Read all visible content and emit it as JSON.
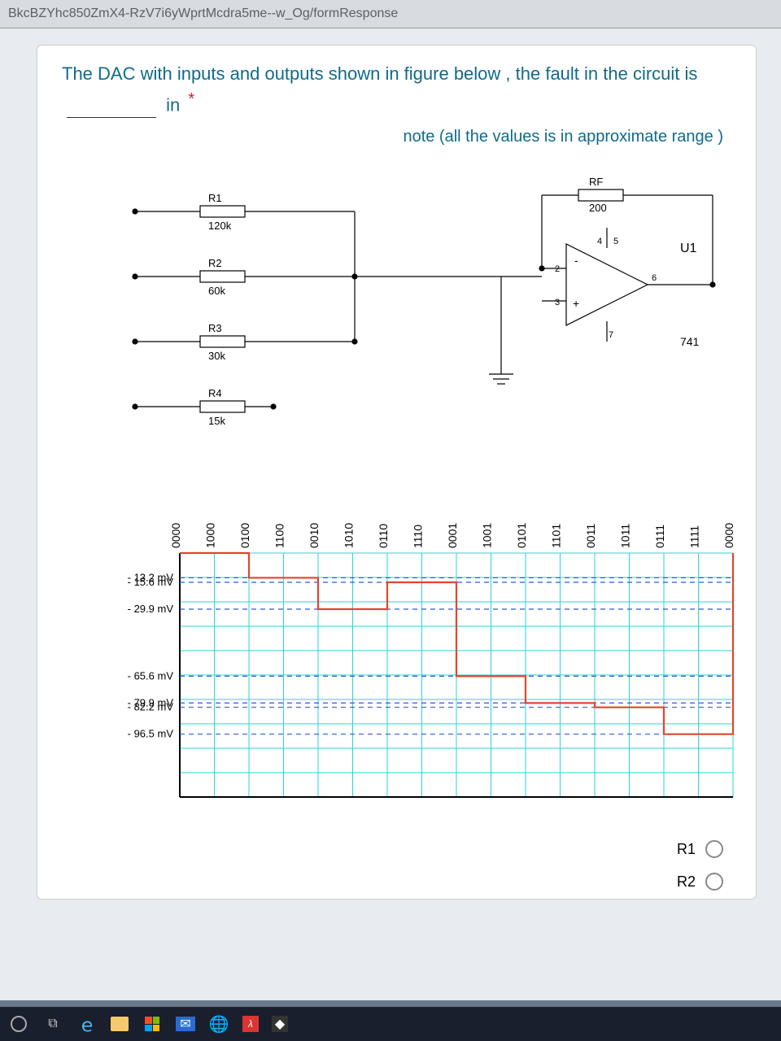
{
  "url": "BkcBZYhc850ZmX4-RzV7i6yWprtMcdra5me--w_Og/formResponse",
  "question": {
    "text_before": "The DAC with inputs and outputs shown in figure below , the fault in the circuit is",
    "text_after": "in",
    "asterisk": "*",
    "note": "note (all the values is in approximate range )"
  },
  "circuit": {
    "r1": {
      "label": "R1",
      "value": "120k"
    },
    "r2": {
      "label": "R2",
      "value": "60k"
    },
    "r3": {
      "label": "R3",
      "value": "30k"
    },
    "r4": {
      "label": "R4",
      "value": "15k"
    },
    "rf": {
      "label": "RF",
      "value": "200"
    },
    "u1": {
      "label": "U1",
      "part": "741"
    },
    "pins": {
      "in_minus": "2",
      "in_plus": "3",
      "v_minus": "4",
      "v_plus": "5",
      "out": "6",
      "nc": "7"
    }
  },
  "chart_data": {
    "type": "line",
    "x_labels": [
      "0000",
      "1000",
      "0100",
      "1100",
      "0010",
      "1010",
      "0110",
      "1110",
      "0001",
      "1001",
      "0101",
      "1101",
      "0011",
      "1011",
      "0111",
      "1111",
      "0000"
    ],
    "y_labels": [
      "- 13.2 mV",
      "- 15.6 mV",
      "- 29.9 mV",
      "- 65.6 mV",
      "- 79.9 mV",
      "- 82.2 mV",
      "- 96.5 mV"
    ],
    "y_values_mv": [
      -13.2,
      -15.6,
      -29.9,
      -65.6,
      -79.9,
      -82.2,
      -96.5
    ],
    "step_values_mv": [
      0,
      0,
      -13.2,
      -13.2,
      -29.9,
      -29.9,
      -15.6,
      -15.6,
      -65.6,
      -65.6,
      -79.9,
      -79.9,
      -82.2,
      -82.2,
      -96.5,
      -96.5,
      0
    ],
    "ylim_mv": [
      -130,
      0
    ]
  },
  "answers": {
    "opt1": "R1",
    "opt2": "R2"
  }
}
